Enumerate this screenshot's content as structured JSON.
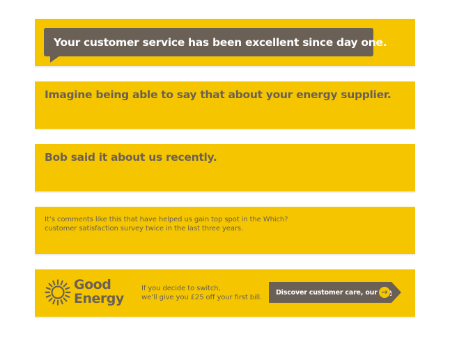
{
  "colors": {
    "accent": "#f5c600",
    "text": "#6a6056",
    "bubble": "#6a6056",
    "white": "#ffffff"
  },
  "panel1": {
    "quote": "Your customer service has been excellent since day one."
  },
  "panel2": {
    "headline": "Imagine being able to say that about your energy supplier."
  },
  "panel3": {
    "headline": "Bob said it about us recently."
  },
  "panel4": {
    "line1": "It’s comments like this that have helped us gain top spot in the Which?",
    "line2": "customer satisfaction survey twice in the last three years."
  },
  "footer": {
    "logo": {
      "line1": "Good",
      "line2": "Energy",
      "icon": "sun-icon"
    },
    "offer_line1": "If you decide to switch,",
    "offer_line2": "we’ll give you £25 off your first bill.",
    "cta_label": "Discover customer care, our way",
    "cta_icon": "arrow-right-icon"
  }
}
